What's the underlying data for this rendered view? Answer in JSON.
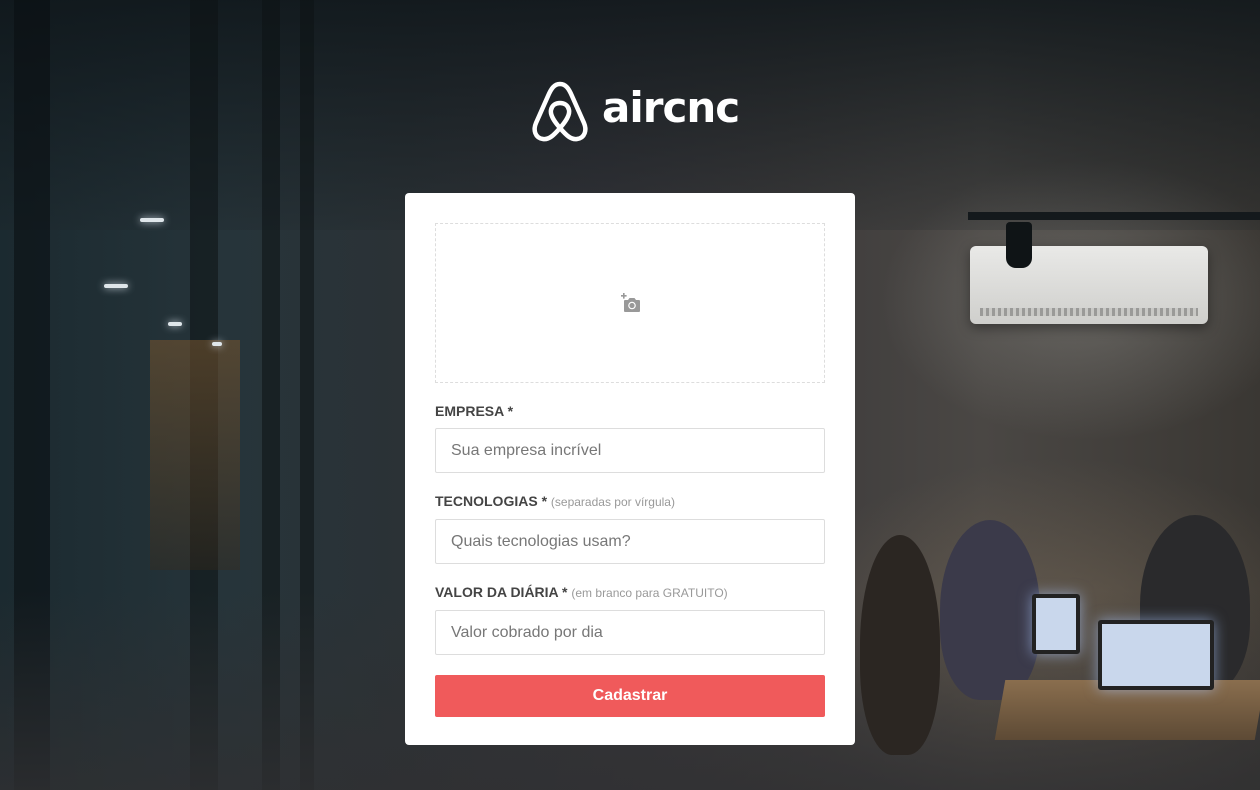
{
  "brand": {
    "name": "aircnc",
    "logo_icon": "airbnb-belo-icon"
  },
  "form": {
    "thumbnail": {
      "icon": "add-photo-camera-icon"
    },
    "company": {
      "label": "EMPRESA",
      "required_mark": "*",
      "placeholder": "Sua empresa incrível",
      "value": ""
    },
    "techs": {
      "label": "TECNOLOGIAS",
      "required_mark": "*",
      "hint": "(separadas por vírgula)",
      "placeholder": "Quais tecnologias usam?",
      "value": ""
    },
    "price": {
      "label": "VALOR DA DIÁRIA",
      "required_mark": "*",
      "hint": "(em branco para GRATUITO)",
      "placeholder": "Valor cobrado por dia",
      "value": ""
    },
    "submit_label": "Cadastrar"
  },
  "colors": {
    "accent": "#f05a5b",
    "card_background": "#ffffff",
    "label_text": "#444444",
    "hint_text": "#999999",
    "border": "#dddddd"
  }
}
